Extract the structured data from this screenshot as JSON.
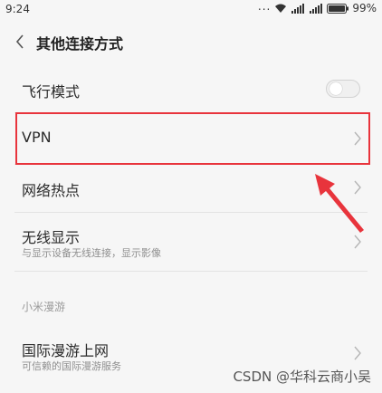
{
  "status_bar": {
    "time": "9:24",
    "dots": "...",
    "battery": "99%"
  },
  "header": {
    "title": "其他连接方式"
  },
  "rows": {
    "airplane": {
      "title": "飞行模式",
      "enabled": false
    },
    "vpn": {
      "title": "VPN"
    },
    "hotspot": {
      "title": "网络热点"
    },
    "wireless_display": {
      "title": "无线显示",
      "subtitle": "与显示设备无线连接，显示影像"
    }
  },
  "section": {
    "label": "小米漫游"
  },
  "roaming": {
    "title": "国际漫游上网",
    "subtitle": "可信赖的国际漫游服务"
  },
  "watermark": "CSDN @华科云商小吴",
  "colors": {
    "highlight": "#e8343c",
    "background": "#f6f6f6"
  }
}
